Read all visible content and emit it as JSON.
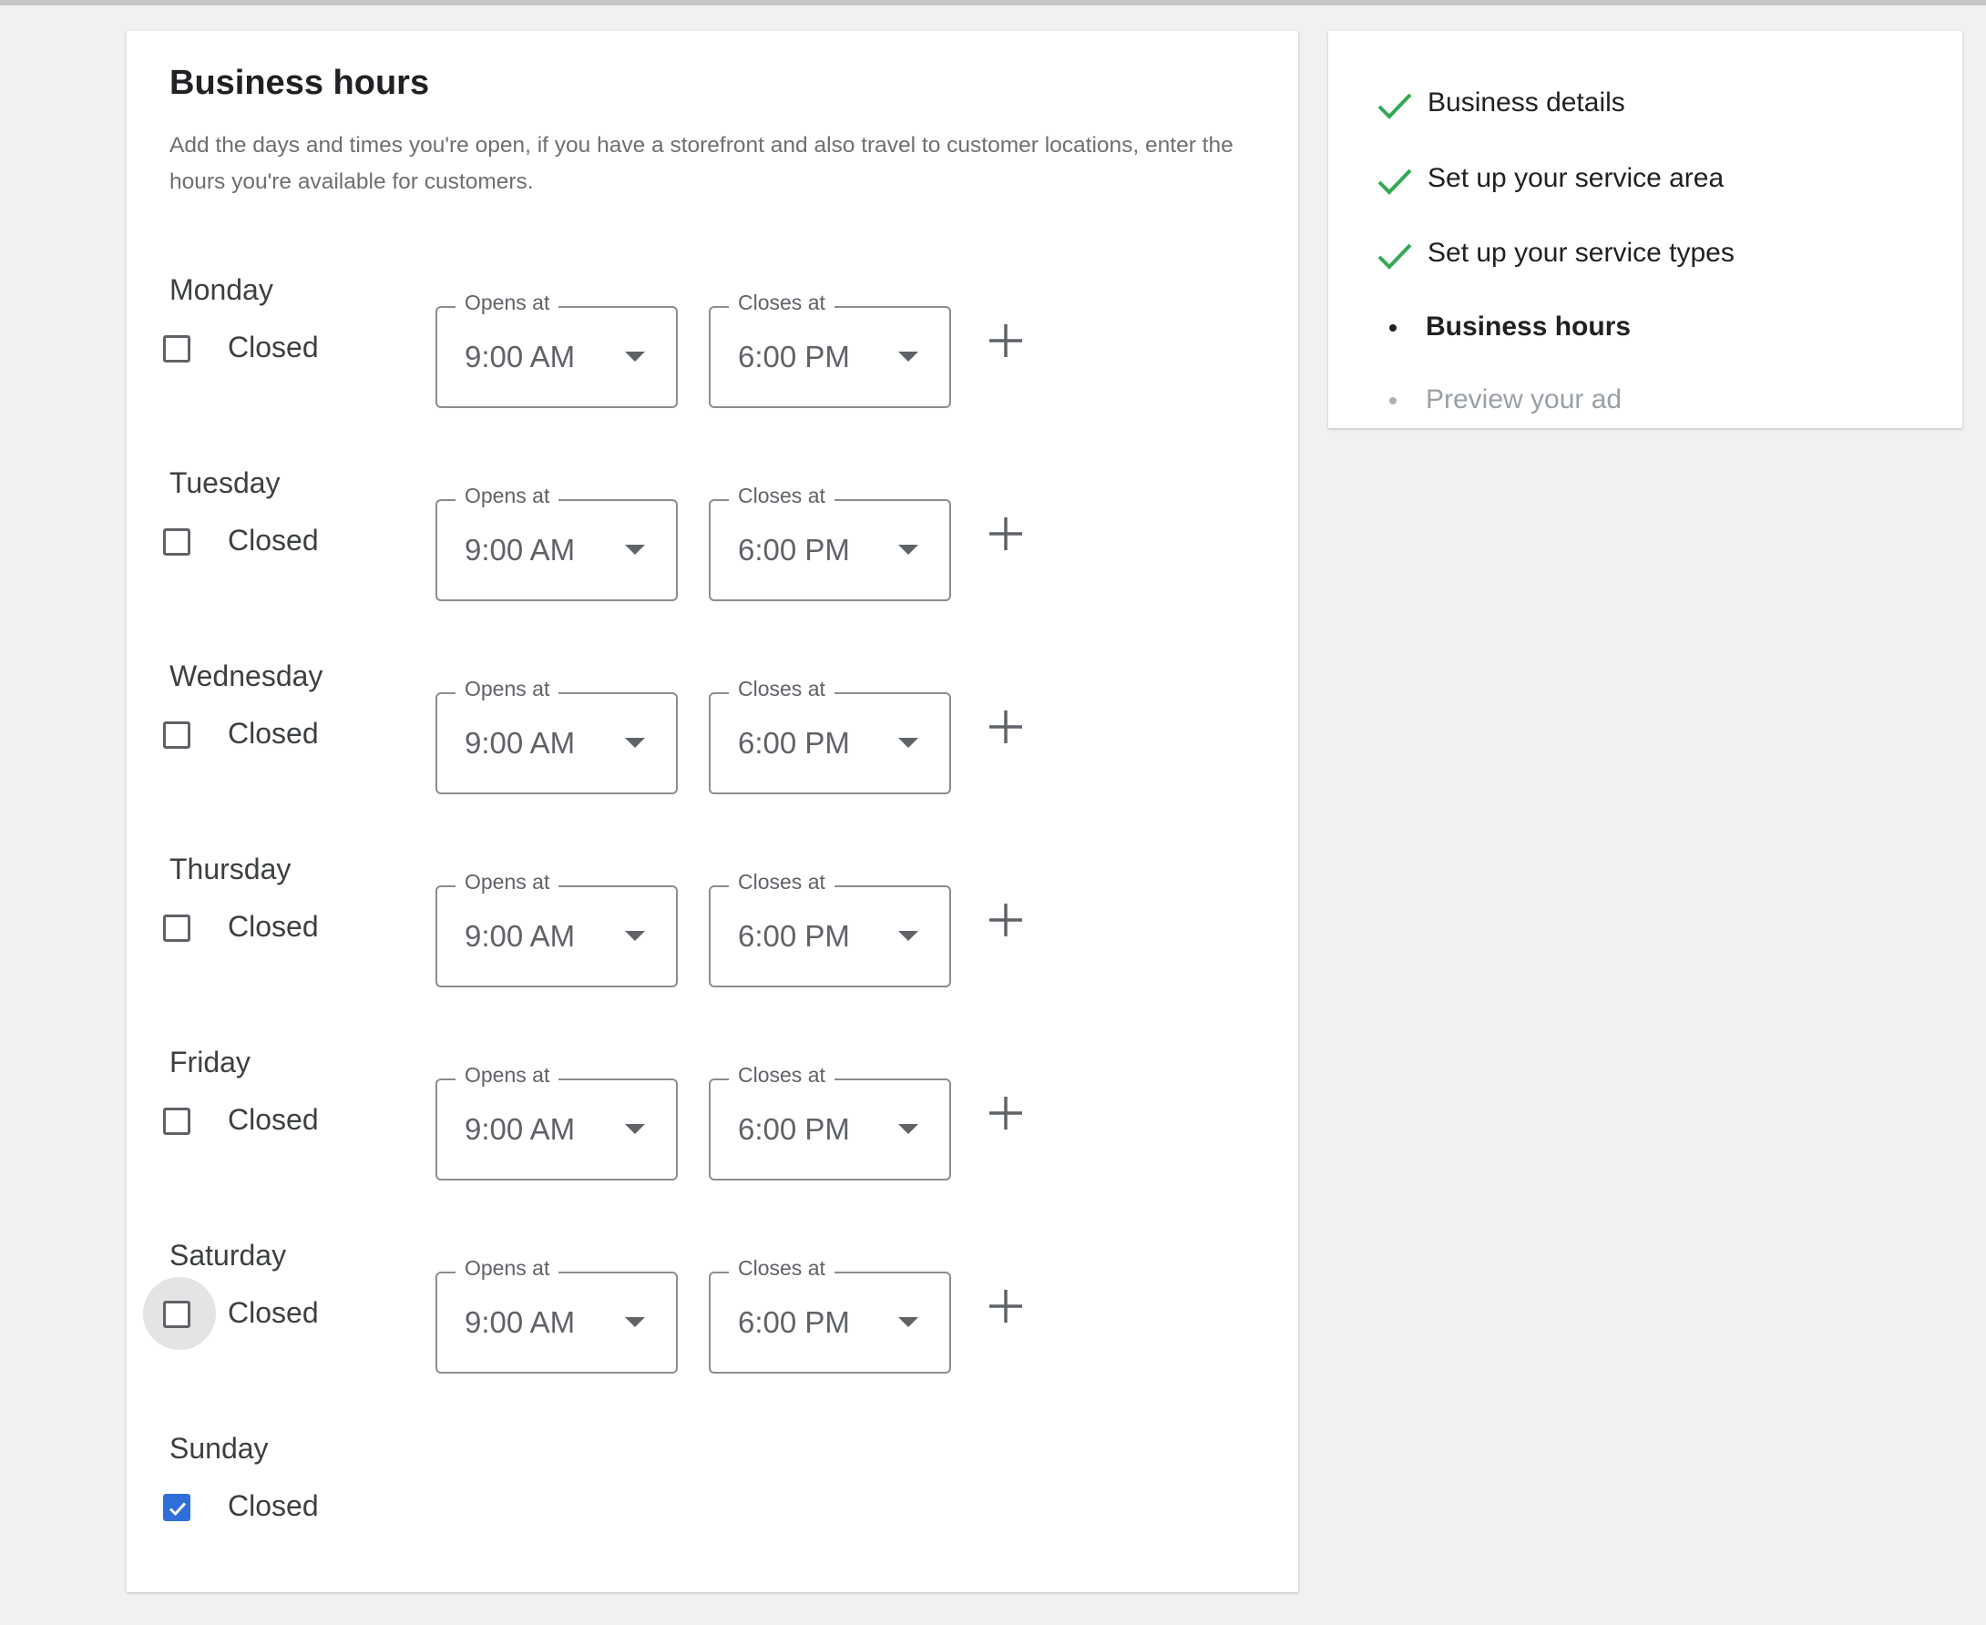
{
  "card": {
    "title": "Business hours",
    "description": "Add the days and times you're open, if you have a storefront and also travel to customer locations, enter the hours you're available for customers."
  },
  "labels": {
    "opens_at": "Opens at",
    "closes_at": "Closes at",
    "closed": "Closed"
  },
  "days": [
    {
      "name": "Monday",
      "closed": false,
      "opens": "9:00 AM",
      "closes": "6:00 PM"
    },
    {
      "name": "Tuesday",
      "closed": false,
      "opens": "9:00 AM",
      "closes": "6:00 PM"
    },
    {
      "name": "Wednesday",
      "closed": false,
      "opens": "9:00 AM",
      "closes": "6:00 PM"
    },
    {
      "name": "Thursday",
      "closed": false,
      "opens": "9:00 AM",
      "closes": "6:00 PM"
    },
    {
      "name": "Friday",
      "closed": false,
      "opens": "9:00 AM",
      "closes": "6:00 PM"
    },
    {
      "name": "Saturday",
      "closed": false,
      "focused": true,
      "opens": "9:00 AM",
      "closes": "6:00 PM"
    },
    {
      "name": "Sunday",
      "closed": true
    }
  ],
  "progress": {
    "steps": [
      {
        "label": "Business details",
        "status": "done"
      },
      {
        "label": "Set up your service area",
        "status": "done"
      },
      {
        "label": "Set up your service types",
        "status": "done"
      },
      {
        "label": "Business hours",
        "status": "current"
      },
      {
        "label": "Preview your ad",
        "status": "pending"
      }
    ]
  },
  "colors": {
    "accent": "#2f6fd9",
    "done_check": "#34a853",
    "background": "#f1f1f1"
  },
  "icons": {
    "step_done": "check-icon",
    "dropdown": "dropdown-arrow-icon",
    "add_hours": "plus-icon",
    "checkbox_checked": "checkmark-icon"
  }
}
